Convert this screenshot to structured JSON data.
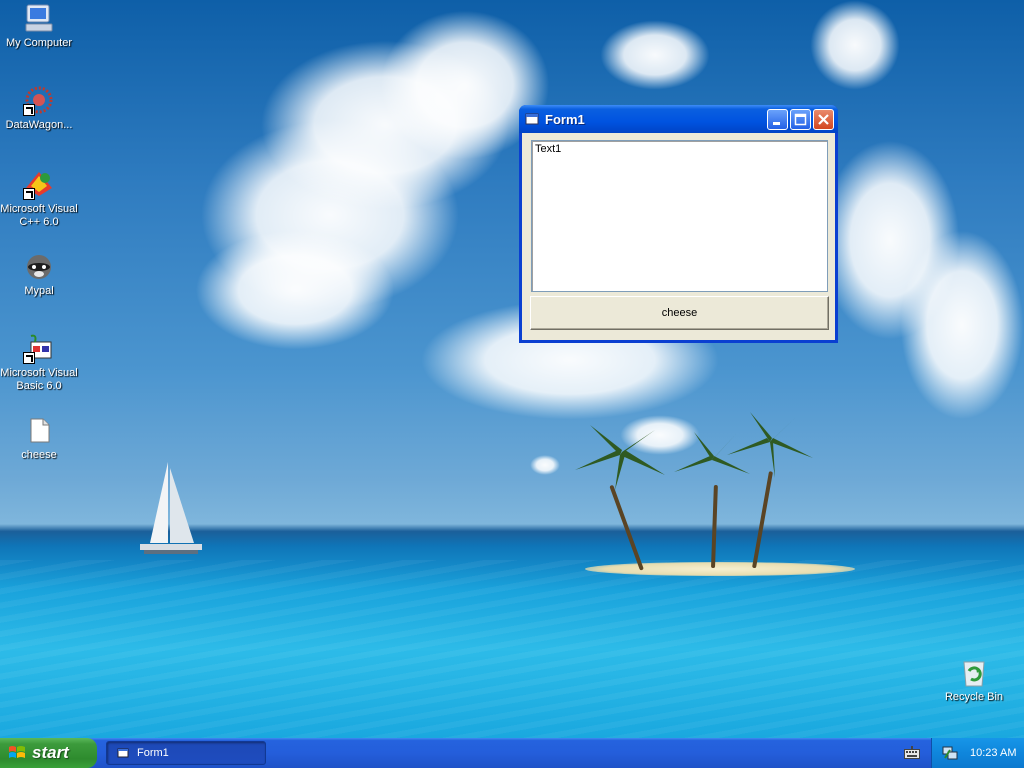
{
  "desktop": {
    "icons": [
      {
        "label": "My Computer",
        "icon": "my-computer-icon"
      },
      {
        "label": "DataWagon...",
        "icon": "datawagon-icon"
      },
      {
        "label": "Microsoft Visual C++ 6.0",
        "icon": "visual-cpp-icon"
      },
      {
        "label": "Mypal",
        "icon": "mypal-icon"
      },
      {
        "label": "Microsoft Visual Basic 6.0",
        "icon": "visual-basic-icon"
      },
      {
        "label": "cheese",
        "icon": "folder-icon"
      },
      {
        "label": "Recycle Bin",
        "icon": "recycle-bin-icon"
      }
    ]
  },
  "window": {
    "title": "Form1",
    "textbox_value": "Text1",
    "button_label": "cheese"
  },
  "taskbar": {
    "start_label": "start",
    "task_button_label": "Form1",
    "clock": "10:23 AM"
  },
  "colors": {
    "title_bar": "#0053e0",
    "taskbar": "#245edb",
    "start_button": "#3c9b3c",
    "window_face": "#ece9d8"
  }
}
